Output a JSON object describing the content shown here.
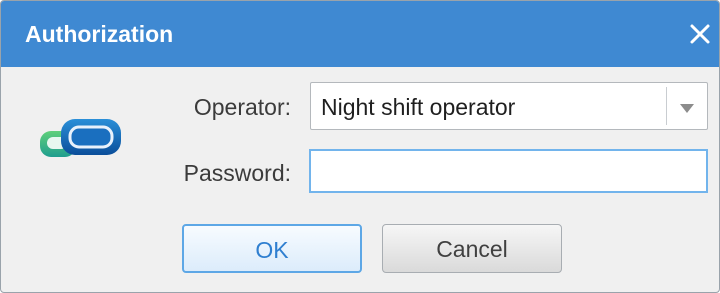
{
  "dialog": {
    "title": "Authorization",
    "operator_label": "Operator:",
    "operator_value": "Night shift operator",
    "password_label": "Password:",
    "password_value": "",
    "ok_label": "OK",
    "cancel_label": "Cancel"
  },
  "icons": {
    "close": "close-icon",
    "logo": "app-logo-icon",
    "dropdown": "chevron-down-icon"
  },
  "colors": {
    "titlebar": "#3f89d2",
    "accent": "#5da7e6",
    "focus": "#72b4ec"
  }
}
